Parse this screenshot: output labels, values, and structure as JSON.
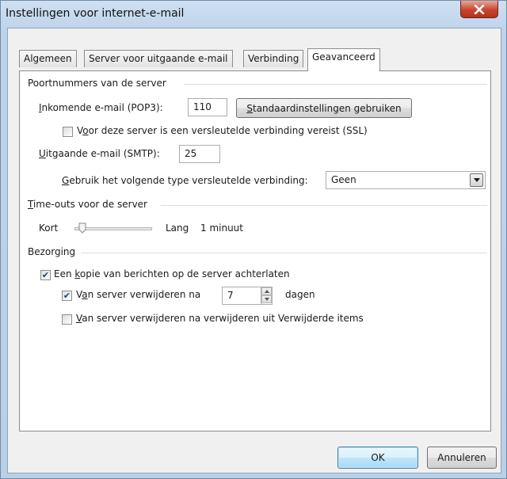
{
  "window": {
    "title": "Instellingen voor internet-e-mail"
  },
  "tabs": [
    {
      "label": "Algemeen"
    },
    {
      "label": "Server voor uitgaande e-mail"
    },
    {
      "label": "Verbinding"
    },
    {
      "label": "Geavanceerd"
    }
  ],
  "ports": {
    "section": "Poortnummers van de server",
    "incoming_label_pre": "",
    "incoming_label_u": "I",
    "incoming_label_post": "nkomende e-mail (POP3):",
    "incoming_value": "110",
    "defaults_button_u": "S",
    "defaults_button_rest": "tandaardinstellingen gebruiken",
    "ssl_label_pre": "V",
    "ssl_label_u": "o",
    "ssl_label_post": "or deze server is een versleutelde verbinding vereist (SSL)",
    "ssl_checked": false,
    "outgoing_label_u": "U",
    "outgoing_label_post": "itgaande e-mail (SMTP):",
    "outgoing_value": "25",
    "encryption_label_u": "G",
    "encryption_label_post": "ebruik het volgende type versleutelde verbinding:",
    "encryption_value": "Geen"
  },
  "timeouts": {
    "section_u": "T",
    "section_post": "ime-outs voor de server",
    "short_label": "Kort",
    "long_label": "Lang",
    "value_text": "1 minuut"
  },
  "delivery": {
    "section": "Bezorging",
    "keep_copy_pre": "Een ",
    "keep_copy_u": "k",
    "keep_copy_post": "opie van berichten op de server achterlaten",
    "keep_copy_checked": true,
    "remove_after_pre": "V",
    "remove_after_u": "a",
    "remove_after_post": "n server verwijderen na",
    "remove_after_checked": true,
    "remove_after_days": "7",
    "days_label": "dagen",
    "remove_deleted_u": "V",
    "remove_deleted_post": "an server verwijderen na verwijderen uit Verwijderde items",
    "remove_deleted_checked": false
  },
  "buttons": {
    "ok": "OK",
    "cancel": "Annuleren"
  },
  "icons": {
    "close": "close-icon",
    "check": "checkmark-icon",
    "dropdown": "chevron-down-icon",
    "spin_up": "spin-up-icon",
    "spin_down": "spin-down-icon"
  }
}
